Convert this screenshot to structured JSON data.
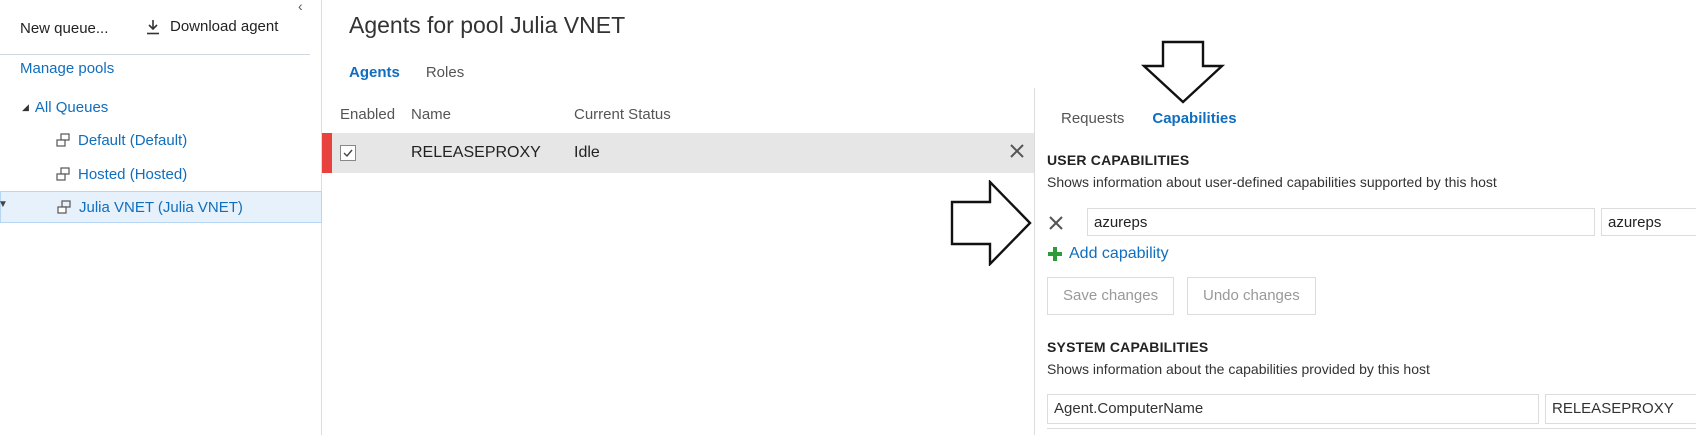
{
  "toolbar": {
    "new_queue": "New queue...",
    "download_agent": "Download agent"
  },
  "left_nav": {
    "manage_pools": "Manage pools",
    "all_queues": "All Queues",
    "queues": [
      {
        "label": "Default (Default)"
      },
      {
        "label": "Hosted (Hosted)"
      },
      {
        "label": "Julia VNET (Julia VNET)"
      }
    ],
    "selected": "Julia VNET (Julia VNET)"
  },
  "main": {
    "title": "Agents for pool Julia VNET",
    "tabs": [
      {
        "label": "Agents",
        "active": true
      },
      {
        "label": "Roles",
        "active": false
      }
    ],
    "columns": [
      "Enabled",
      "Name",
      "Current Status"
    ],
    "agents": [
      {
        "enabled": true,
        "name": "RELEASEPROXY",
        "status": "Idle"
      }
    ]
  },
  "details": {
    "tabs": [
      {
        "label": "Requests",
        "active": false
      },
      {
        "label": "Capabilities",
        "active": true
      }
    ],
    "user_capabilities": {
      "title": "USER CAPABILITIES",
      "description": "Shows information about user-defined capabilities supported by this host",
      "rows": [
        {
          "key": "azureps",
          "value": "azureps"
        }
      ],
      "add_label": "Add capability",
      "save_label": "Save changes",
      "undo_label": "Undo changes"
    },
    "system_capabilities": {
      "title": "SYSTEM CAPABILITIES",
      "description": "Shows information about the capabilities provided by this host",
      "rows": [
        {
          "key": "Agent.ComputerName",
          "value": "RELEASEPROXY"
        }
      ]
    }
  },
  "colors": {
    "accent": "#106ebe",
    "selected_bg": "#e6f1fb",
    "status_stripe": "#e8423f",
    "add_icon": "#2e9a3a"
  },
  "icons": [
    "download-icon",
    "queue-icon",
    "checkbox-checked-icon",
    "close-icon",
    "plus-icon",
    "chevron-left-icon",
    "expand-triangle-icon"
  ]
}
